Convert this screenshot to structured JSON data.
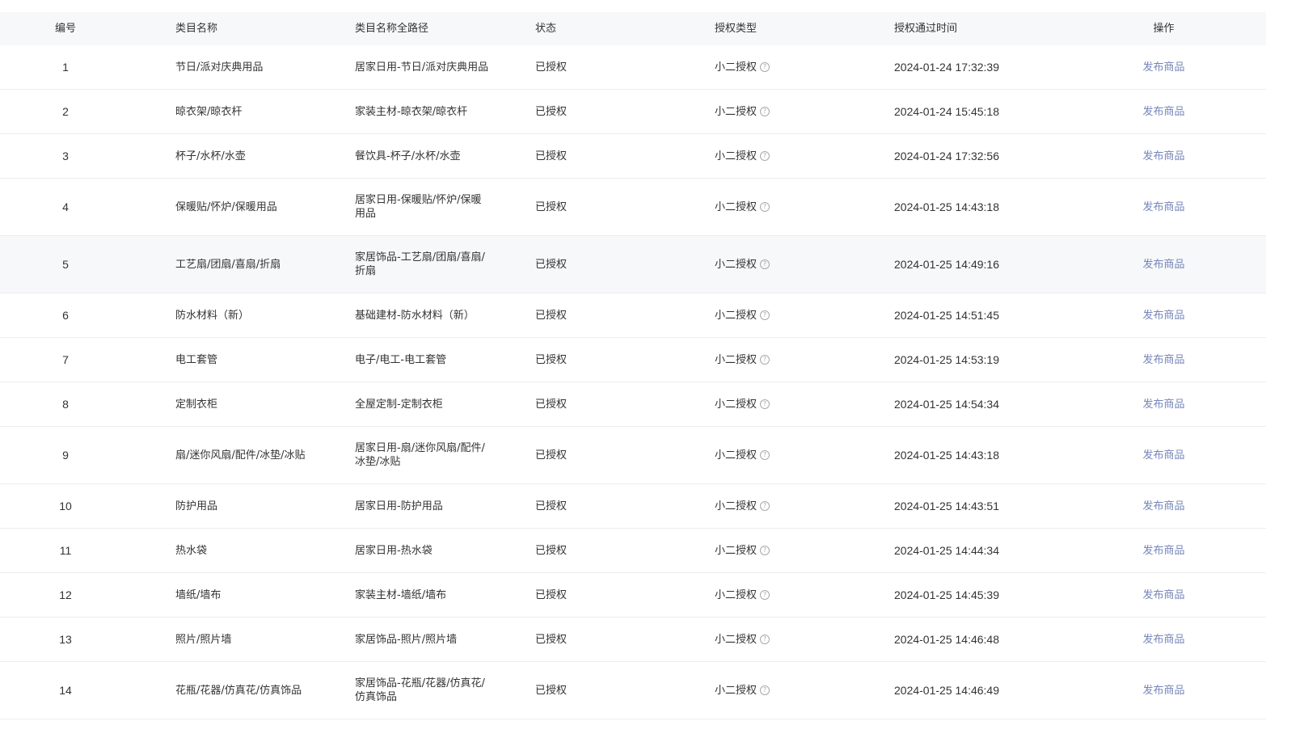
{
  "table": {
    "headers": {
      "id": "编号",
      "name": "类目名称",
      "path": "类目名称全路径",
      "status": "状态",
      "auth_type": "授权类型",
      "auth_time": "授权通过时间",
      "action": "操作"
    },
    "rows": [
      {
        "id": "1",
        "name": "节日/派对庆典用品",
        "path": "居家日用-节日/派对庆典用品",
        "status": "已授权",
        "auth_type": "小二授权",
        "auth_time": "2024-01-24 17:32:39",
        "action": "发布商品"
      },
      {
        "id": "2",
        "name": "晾衣架/晾衣杆",
        "path": "家装主材-晾衣架/晾衣杆",
        "status": "已授权",
        "auth_type": "小二授权",
        "auth_time": "2024-01-24 15:45:18",
        "action": "发布商品"
      },
      {
        "id": "3",
        "name": "杯子/水杯/水壶",
        "path": "餐饮具-杯子/水杯/水壶",
        "status": "已授权",
        "auth_type": "小二授权",
        "auth_time": "2024-01-24 17:32:56",
        "action": "发布商品"
      },
      {
        "id": "4",
        "name": "保暖贴/怀炉/保暖用品",
        "path": "居家日用-保暖贴/怀炉/保暖用品",
        "status": "已授权",
        "auth_type": "小二授权",
        "auth_time": "2024-01-25 14:43:18",
        "action": "发布商品"
      },
      {
        "id": "5",
        "name": "工艺扇/团扇/喜扇/折扇",
        "path": "家居饰品-工艺扇/团扇/喜扇/折扇",
        "status": "已授权",
        "auth_type": "小二授权",
        "auth_time": "2024-01-25 14:49:16",
        "action": "发布商品"
      },
      {
        "id": "6",
        "name": "防水材料（新）",
        "path": "基础建材-防水材料（新）",
        "status": "已授权",
        "auth_type": "小二授权",
        "auth_time": "2024-01-25 14:51:45",
        "action": "发布商品"
      },
      {
        "id": "7",
        "name": "电工套管",
        "path": "电子/电工-电工套管",
        "status": "已授权",
        "auth_type": "小二授权",
        "auth_time": "2024-01-25 14:53:19",
        "action": "发布商品"
      },
      {
        "id": "8",
        "name": "定制衣柜",
        "path": "全屋定制-定制衣柜",
        "status": "已授权",
        "auth_type": "小二授权",
        "auth_time": "2024-01-25 14:54:34",
        "action": "发布商品"
      },
      {
        "id": "9",
        "name": "扇/迷你风扇/配件/冰垫/冰贴",
        "path": "居家日用-扇/迷你风扇/配件/冰垫/冰贴",
        "status": "已授权",
        "auth_type": "小二授权",
        "auth_time": "2024-01-25 14:43:18",
        "action": "发布商品"
      },
      {
        "id": "10",
        "name": "防护用品",
        "path": "居家日用-防护用品",
        "status": "已授权",
        "auth_type": "小二授权",
        "auth_time": "2024-01-25 14:43:51",
        "action": "发布商品"
      },
      {
        "id": "11",
        "name": "热水袋",
        "path": "居家日用-热水袋",
        "status": "已授权",
        "auth_type": "小二授权",
        "auth_time": "2024-01-25 14:44:34",
        "action": "发布商品"
      },
      {
        "id": "12",
        "name": "墙纸/墙布",
        "path": "家装主材-墙纸/墙布",
        "status": "已授权",
        "auth_type": "小二授权",
        "auth_time": "2024-01-25 14:45:39",
        "action": "发布商品"
      },
      {
        "id": "13",
        "name": "照片/照片墙",
        "path": "家居饰品-照片/照片墙",
        "status": "已授权",
        "auth_type": "小二授权",
        "auth_time": "2024-01-25 14:46:48",
        "action": "发布商品"
      },
      {
        "id": "14",
        "name": "花瓶/花器/仿真花/仿真饰品",
        "path": "家居饰品-花瓶/花器/仿真花/仿真饰品",
        "status": "已授权",
        "auth_type": "小二授权",
        "auth_time": "2024-01-25 14:46:49",
        "action": "发布商品"
      }
    ]
  }
}
